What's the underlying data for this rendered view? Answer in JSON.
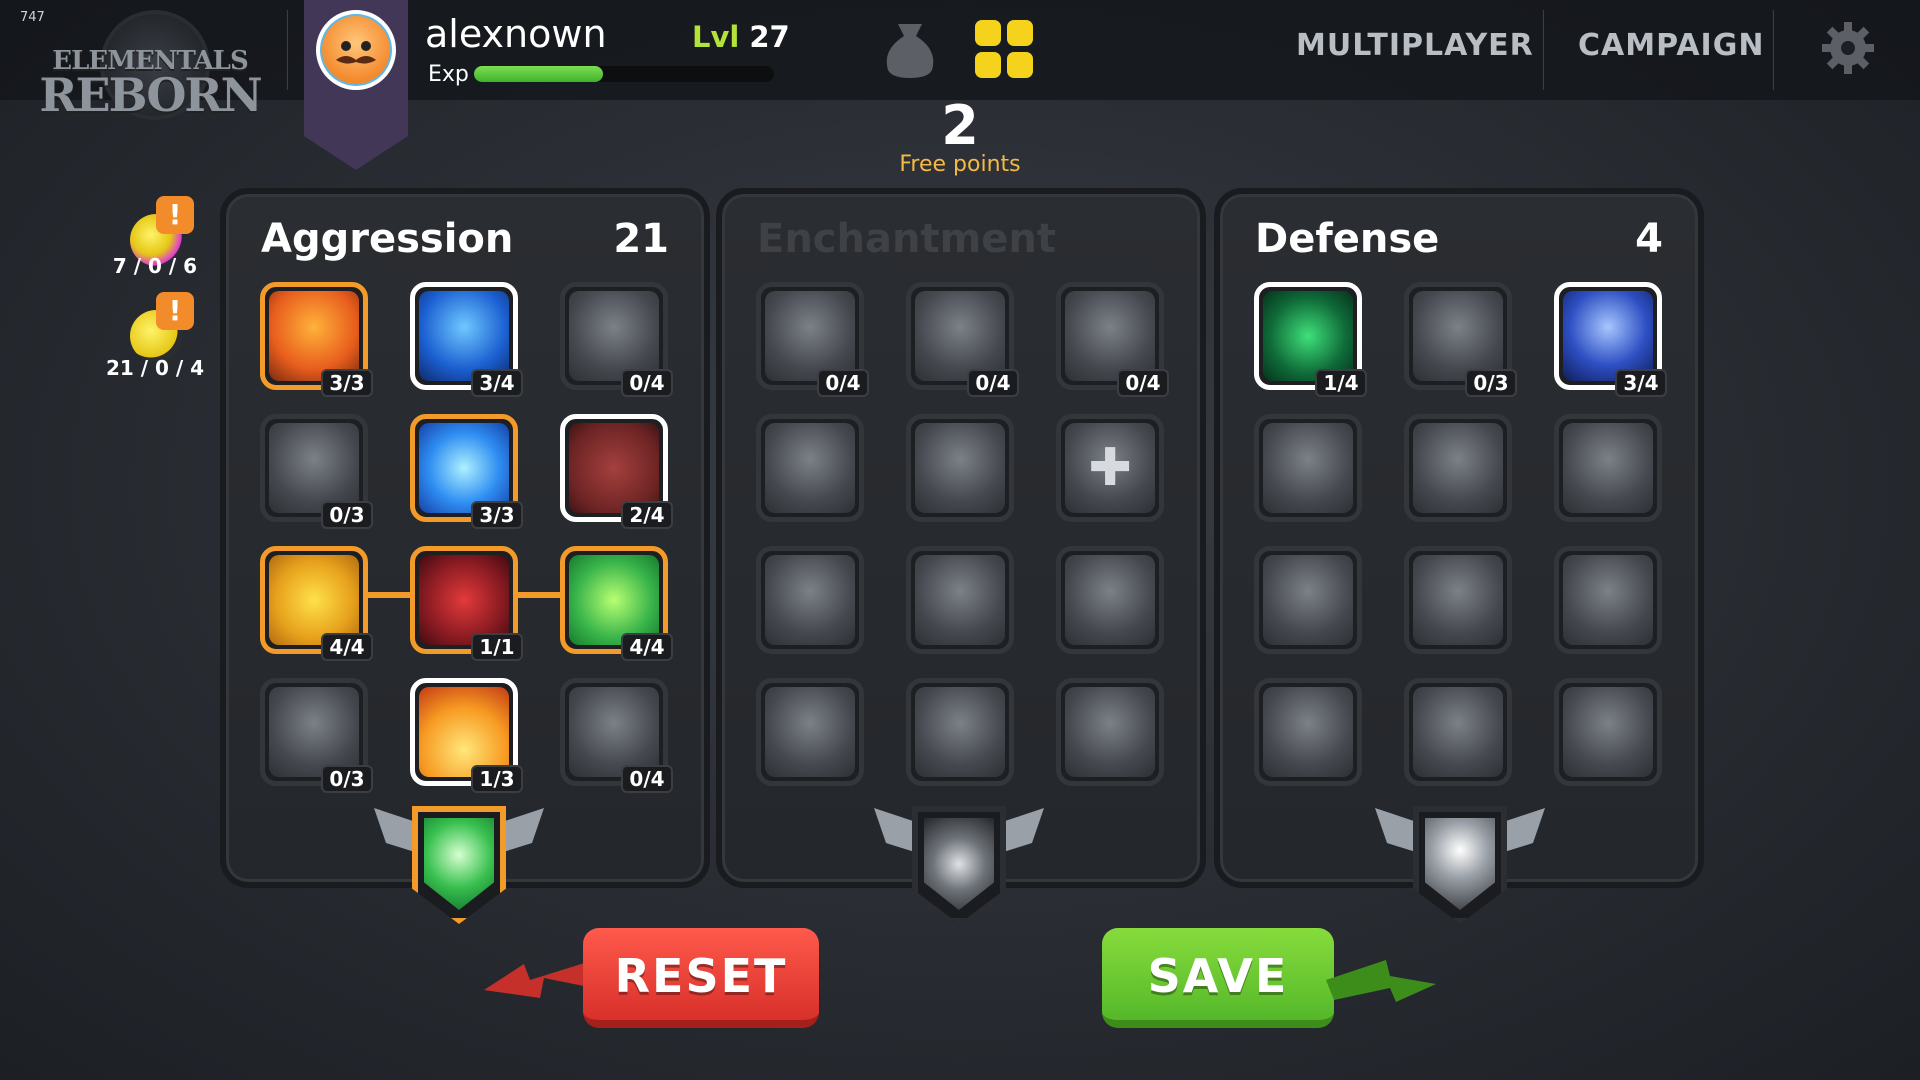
{
  "fps": "747",
  "logo": {
    "line1": "ELEMENTALS",
    "line2": "REBORN"
  },
  "user": {
    "name": "alexnown",
    "level_label": "Lvl",
    "level": "27",
    "exp_label": "Exp",
    "exp_progress": 0.43
  },
  "nav": {
    "multiplayer": "MULTIPLAYER",
    "campaign": "CAMPAIGN"
  },
  "free_points": {
    "value": "2",
    "label": "Free points"
  },
  "side": [
    {
      "count": "7 / 0 / 6",
      "alert": "!"
    },
    {
      "count": "21 / 0 / 4",
      "alert": "!"
    }
  ],
  "panels": [
    {
      "title": "Aggression",
      "count": "21",
      "tiles": [
        [
          "3/3",
          "3/4",
          "0/4"
        ],
        [
          "0/3",
          "3/3",
          "2/4"
        ],
        [
          "4/4",
          "1/1",
          "4/4"
        ],
        [
          "0/3",
          "1/3",
          "0/4"
        ]
      ]
    },
    {
      "title": "Enchantment",
      "count": "",
      "tiles": [
        [
          "0/4",
          "0/4",
          "0/4"
        ],
        [
          "",
          "",
          ""
        ],
        [
          "",
          "",
          ""
        ],
        [
          "",
          "",
          ""
        ]
      ]
    },
    {
      "title": "Defense",
      "count": "4",
      "tiles": [
        [
          "1/4",
          "0/3",
          "3/4"
        ],
        [
          "",
          "",
          ""
        ],
        [
          "",
          "",
          ""
        ],
        [
          "",
          "",
          ""
        ]
      ]
    }
  ],
  "buttons": {
    "reset": "RESET",
    "save": "SAVE"
  },
  "colors": {
    "accent_orange": "#f29b2a",
    "reset_red": "#e23b33",
    "save_green": "#62c42f",
    "xp_green": "#5cc93d",
    "free_points": "#f5b945"
  }
}
